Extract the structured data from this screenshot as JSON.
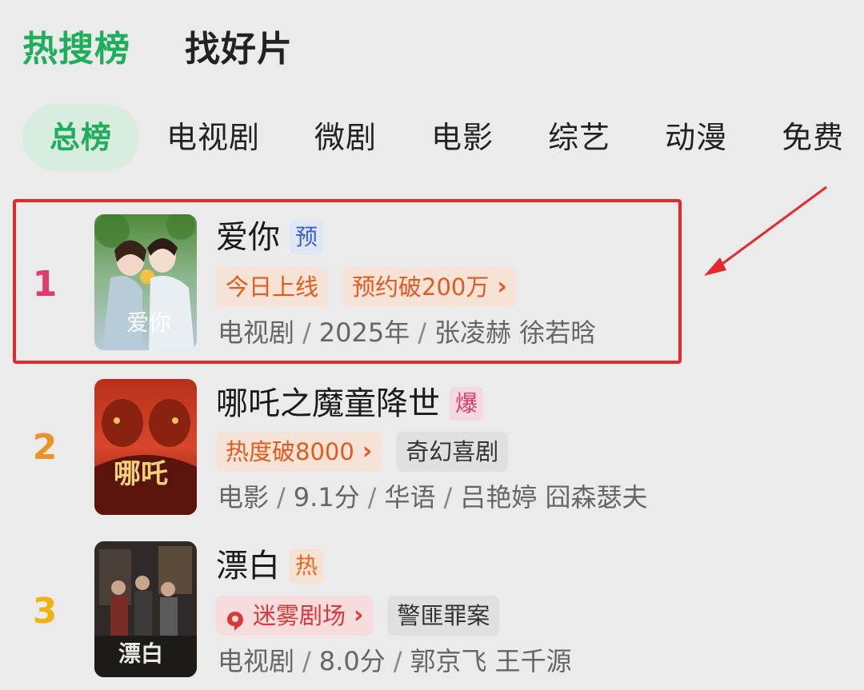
{
  "header": {
    "tabs": [
      {
        "label": "热搜榜",
        "active": true
      },
      {
        "label": "找好片",
        "active": false
      }
    ]
  },
  "categories": [
    {
      "label": "总榜",
      "active": true
    },
    {
      "label": "电视剧",
      "active": false
    },
    {
      "label": "微剧",
      "active": false
    },
    {
      "label": "电影",
      "active": false
    },
    {
      "label": "综艺",
      "active": false
    },
    {
      "label": "动漫",
      "active": false
    },
    {
      "label": "免费",
      "active": false
    }
  ],
  "colors": {
    "accent_green": "#1fae5b",
    "rank1": "#e03b6a",
    "rank2": "#e8942a",
    "rank3": "#f0b20c",
    "highlight_red": "#e5292b"
  },
  "items": [
    {
      "rank": "1",
      "title": "爱你",
      "tag": "预",
      "badges": [
        {
          "text": "今日上线",
          "chevron": false,
          "style": "warm"
        },
        {
          "text": "预约破200万",
          "chevron": true,
          "style": "warm"
        }
      ],
      "meta": [
        "电视剧",
        "2025年",
        "张凌赫 徐若晗"
      ],
      "poster_text": "爱你",
      "highlighted": true
    },
    {
      "rank": "2",
      "title": "哪吒之魔童降世",
      "tag": "爆",
      "badges": [
        {
          "text": "热度破8000",
          "chevron": true,
          "style": "warm"
        },
        {
          "text": "奇幻喜剧",
          "chevron": false,
          "style": "gray"
        }
      ],
      "meta": [
        "电影",
        "9.1分",
        "华语",
        "吕艳婷 囧森瑟夫"
      ],
      "poster_text": "哪吒"
    },
    {
      "rank": "3",
      "title": "漂白",
      "tag": "热",
      "badges": [
        {
          "text": "迷雾剧场",
          "chevron": true,
          "style": "red",
          "icon": "mist-theater-icon"
        },
        {
          "text": "警匪罪案",
          "chevron": false,
          "style": "gray"
        }
      ],
      "meta": [
        "电视剧",
        "8.0分",
        "郭京飞 王千源"
      ],
      "poster_text": "漂白"
    }
  ]
}
